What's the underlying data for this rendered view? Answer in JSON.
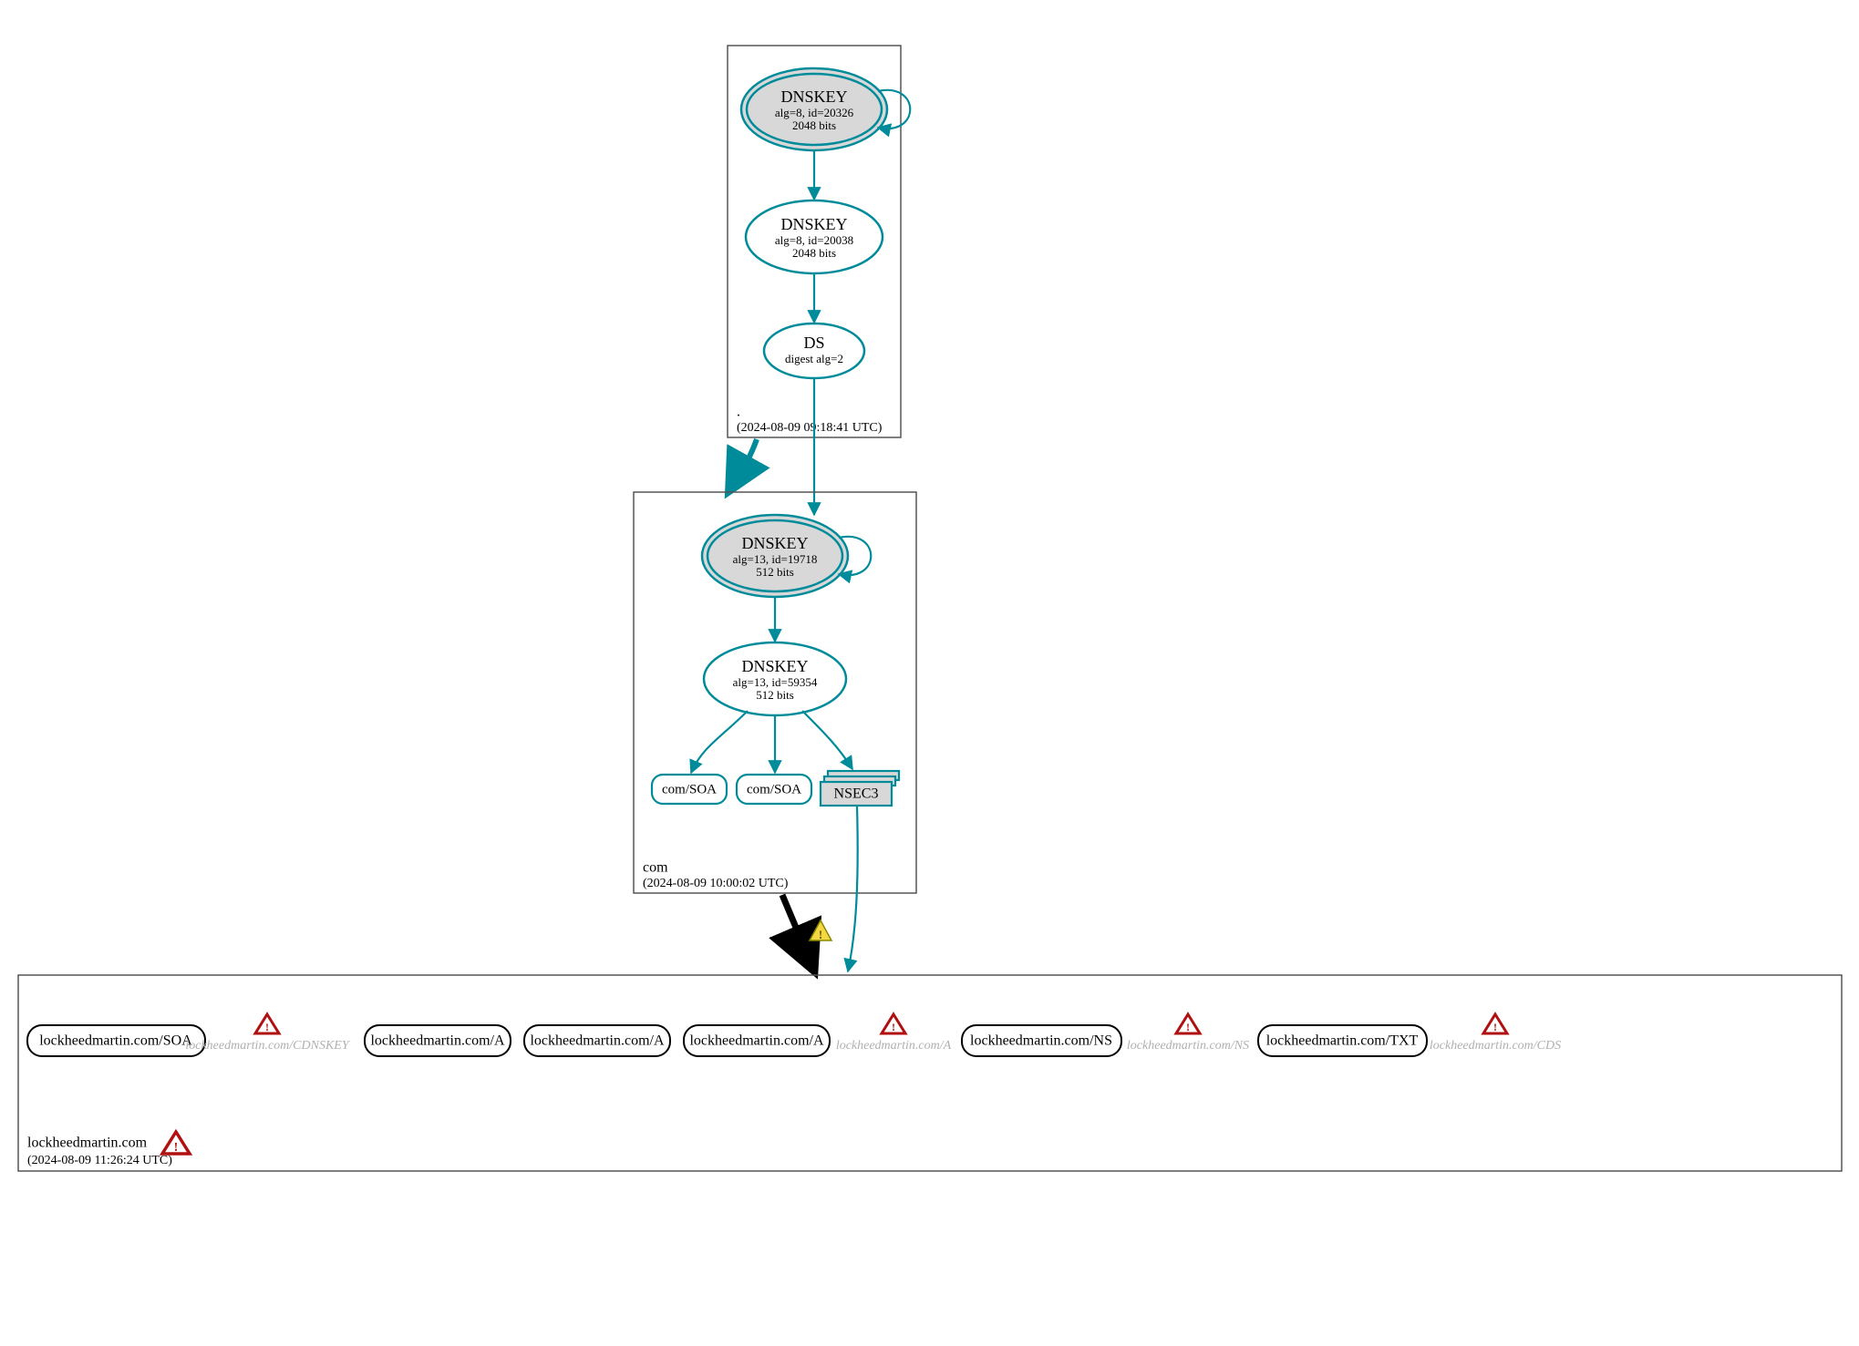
{
  "colors": {
    "teal": "#008b9b",
    "fillGray": "#d8d8d8",
    "warnRed": "#b01010",
    "warnYellow": "#f5d742"
  },
  "zones": {
    "root": {
      "label": ".",
      "timestamp": "(2024-08-09 09:18:41 UTC)",
      "nodes": {
        "ksk": {
          "title": "DNSKEY",
          "line2": "alg=8, id=20326",
          "line3": "2048 bits"
        },
        "zsk": {
          "title": "DNSKEY",
          "line2": "alg=8, id=20038",
          "line3": "2048 bits"
        },
        "ds": {
          "title": "DS",
          "line2": "digest alg=2"
        }
      }
    },
    "com": {
      "label": "com",
      "timestamp": "(2024-08-09 10:00:02 UTC)",
      "nodes": {
        "ksk": {
          "title": "DNSKEY",
          "line2": "alg=13, id=19718",
          "line3": "512 bits"
        },
        "zsk": {
          "title": "DNSKEY",
          "line2": "alg=13, id=59354",
          "line3": "512 bits"
        },
        "soa1": {
          "label": "com/SOA"
        },
        "soa2": {
          "label": "com/SOA"
        },
        "nsec3": {
          "label": "NSEC3"
        }
      }
    },
    "lm": {
      "label": "lockheedmartin.com",
      "timestamp": "(2024-08-09 11:26:24 UTC)",
      "rr": {
        "soa": "lockheedmartin.com/SOA",
        "cdnskey": "lockheedmartin.com/CDNSKEY",
        "a1": "lockheedmartin.com/A",
        "a2": "lockheedmartin.com/A",
        "a3": "lockheedmartin.com/A",
        "a4": "lockheedmartin.com/A",
        "ns1": "lockheedmartin.com/NS",
        "ns2": "lockheedmartin.com/NS",
        "txt": "lockheedmartin.com/TXT",
        "cds": "lockheedmartin.com/CDS"
      }
    }
  }
}
